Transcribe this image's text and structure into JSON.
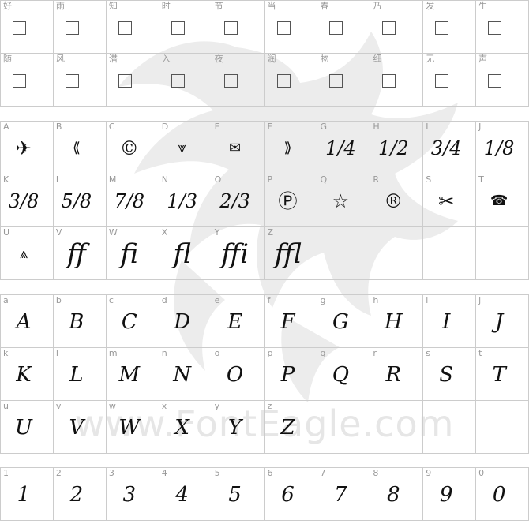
{
  "watermark": {
    "text": "www.FontEagle.com"
  },
  "section_cjk": {
    "cells": [
      {
        "label": "好"
      },
      {
        "label": "雨"
      },
      {
        "label": "知"
      },
      {
        "label": "时"
      },
      {
        "label": "节"
      },
      {
        "label": "当"
      },
      {
        "label": "春"
      },
      {
        "label": "乃"
      },
      {
        "label": "发"
      },
      {
        "label": "生"
      },
      {
        "label": "随"
      },
      {
        "label": "风"
      },
      {
        "label": "潜"
      },
      {
        "label": "入"
      },
      {
        "label": "夜"
      },
      {
        "label": "润"
      },
      {
        "label": "物"
      },
      {
        "label": "细"
      },
      {
        "label": "无"
      },
      {
        "label": "声"
      }
    ]
  },
  "section_symbols": {
    "cells": [
      {
        "label": "A",
        "glyph": "✈"
      },
      {
        "label": "B",
        "glyph": "⟪"
      },
      {
        "label": "C",
        "glyph": "©"
      },
      {
        "label": "D",
        "glyph": "⩔"
      },
      {
        "label": "E",
        "glyph": "✉"
      },
      {
        "label": "F",
        "glyph": "⟫"
      },
      {
        "label": "G",
        "glyph": "1/4"
      },
      {
        "label": "H",
        "glyph": "1/2"
      },
      {
        "label": "I",
        "glyph": "3/4"
      },
      {
        "label": "J",
        "glyph": "1/8"
      },
      {
        "label": "K",
        "glyph": "3/8"
      },
      {
        "label": "L",
        "glyph": "5/8"
      },
      {
        "label": "M",
        "glyph": "7/8"
      },
      {
        "label": "N",
        "glyph": "1/3"
      },
      {
        "label": "O",
        "glyph": "2/3"
      },
      {
        "label": "P",
        "glyph": "Ⓟ"
      },
      {
        "label": "Q",
        "glyph": "☆"
      },
      {
        "label": "R",
        "glyph": "®"
      },
      {
        "label": "S",
        "glyph": "✂"
      },
      {
        "label": "T",
        "glyph": "☎"
      },
      {
        "label": "U",
        "glyph": "⩓"
      },
      {
        "label": "V",
        "glyph": "ff"
      },
      {
        "label": "W",
        "glyph": "fi"
      },
      {
        "label": "X",
        "glyph": "fl"
      },
      {
        "label": "Y",
        "glyph": "ffi"
      },
      {
        "label": "Z",
        "glyph": "ffl"
      },
      {
        "label": "",
        "glyph": ""
      },
      {
        "label": "",
        "glyph": ""
      },
      {
        "label": "",
        "glyph": ""
      },
      {
        "label": "",
        "glyph": ""
      }
    ]
  },
  "section_lower": {
    "cells": [
      {
        "label": "a",
        "glyph": "A"
      },
      {
        "label": "b",
        "glyph": "B"
      },
      {
        "label": "c",
        "glyph": "C"
      },
      {
        "label": "d",
        "glyph": "D"
      },
      {
        "label": "e",
        "glyph": "E"
      },
      {
        "label": "f",
        "glyph": "F"
      },
      {
        "label": "g",
        "glyph": "G"
      },
      {
        "label": "h",
        "glyph": "H"
      },
      {
        "label": "i",
        "glyph": "I"
      },
      {
        "label": "j",
        "glyph": "J"
      },
      {
        "label": "k",
        "glyph": "K"
      },
      {
        "label": "l",
        "glyph": "L"
      },
      {
        "label": "m",
        "glyph": "M"
      },
      {
        "label": "n",
        "glyph": "N"
      },
      {
        "label": "o",
        "glyph": "O"
      },
      {
        "label": "p",
        "glyph": "P"
      },
      {
        "label": "q",
        "glyph": "Q"
      },
      {
        "label": "r",
        "glyph": "R"
      },
      {
        "label": "s",
        "glyph": "S"
      },
      {
        "label": "t",
        "glyph": "T"
      },
      {
        "label": "u",
        "glyph": "U"
      },
      {
        "label": "v",
        "glyph": "V"
      },
      {
        "label": "w",
        "glyph": "W"
      },
      {
        "label": "x",
        "glyph": "X"
      },
      {
        "label": "y",
        "glyph": "Y"
      },
      {
        "label": "z",
        "glyph": "Z"
      },
      {
        "label": "",
        "glyph": ""
      },
      {
        "label": "",
        "glyph": ""
      },
      {
        "label": "",
        "glyph": ""
      },
      {
        "label": "",
        "glyph": ""
      }
    ]
  },
  "section_digits": {
    "cells": [
      {
        "label": "1",
        "glyph": "1"
      },
      {
        "label": "2",
        "glyph": "2"
      },
      {
        "label": "3",
        "glyph": "3"
      },
      {
        "label": "4",
        "glyph": "4"
      },
      {
        "label": "5",
        "glyph": "5"
      },
      {
        "label": "6",
        "glyph": "6"
      },
      {
        "label": "7",
        "glyph": "7"
      },
      {
        "label": "8",
        "glyph": "8"
      },
      {
        "label": "9",
        "glyph": "9"
      },
      {
        "label": "0",
        "glyph": "0"
      }
    ]
  }
}
